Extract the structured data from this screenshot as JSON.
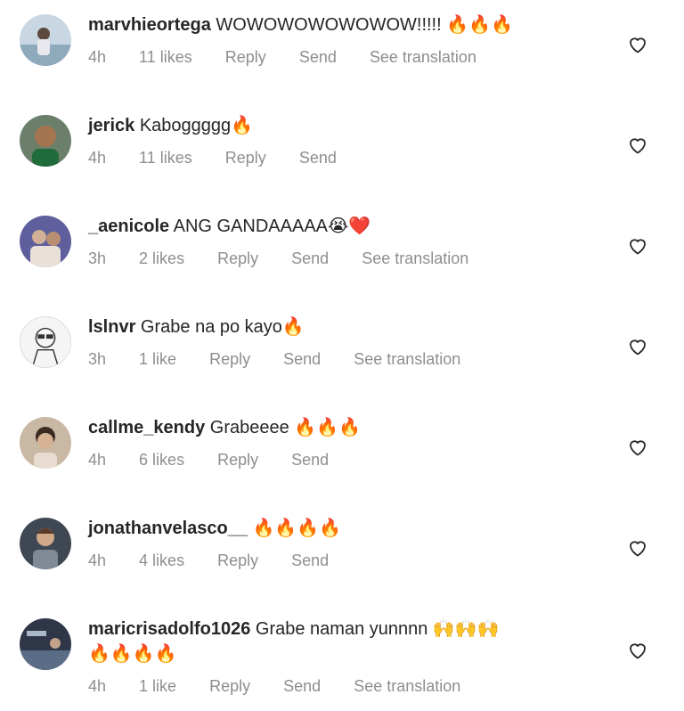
{
  "comments": [
    {
      "username": "marvhieortega",
      "text": "WOWOWOWOWOWOW!!!!! 🔥🔥🔥",
      "time": "4h",
      "likes": "11 likes",
      "reply": "Reply",
      "send": "Send",
      "translation": "See translation",
      "avatar_color": "#9bb4c8"
    },
    {
      "username": "jerick",
      "text": "Kaboggggg🔥",
      "time": "4h",
      "likes": "11 likes",
      "reply": "Reply",
      "send": "Send",
      "translation": "",
      "avatar_color": "#3a5a3a"
    },
    {
      "username": "_aenicole",
      "text": "ANG GANDAAAAA😭❤️",
      "time": "3h",
      "likes": "2 likes",
      "reply": "Reply",
      "send": "Send",
      "translation": "See translation",
      "avatar_color": "#7a7fa8"
    },
    {
      "username": "lslnvr",
      "text": "Grabe na po kayo🔥",
      "time": "3h",
      "likes": "1 like",
      "reply": "Reply",
      "send": "Send",
      "translation": "See translation",
      "avatar_color": "#f2f2f2"
    },
    {
      "username": "callme_kendy",
      "text": "Grabeeee 🔥🔥🔥",
      "time": "4h",
      "likes": "6 likes",
      "reply": "Reply",
      "send": "Send",
      "translation": "",
      "avatar_color": "#8a7c6e"
    },
    {
      "username": "jonathanvelasco__",
      "text": "🔥🔥🔥🔥",
      "time": "4h",
      "likes": "4 likes",
      "reply": "Reply",
      "send": "Send",
      "translation": "",
      "avatar_color": "#5a6470"
    },
    {
      "username": "maricrisadolfo1026",
      "text": "Grabe naman yunnnn 🙌🙌🙌",
      "text2": "🔥🔥🔥🔥",
      "time": "4h",
      "likes": "1 like",
      "reply": "Reply",
      "send": "Send",
      "translation": "See translation",
      "avatar_color": "#3c4658"
    }
  ],
  "icons": {
    "like": "heart-outline-icon"
  },
  "colors": {
    "text": "#262626",
    "meta": "#8e8e8e"
  }
}
